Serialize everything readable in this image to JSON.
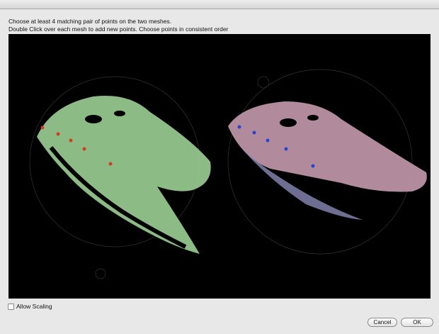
{
  "instructions": {
    "line1": "Choose at least 4 matching pair of points on the two meshes.",
    "line2": "Double Click over each mesh to add new points. Choose points in consistent order"
  },
  "options": {
    "allow_scaling_label": "Allow Scaling",
    "allow_scaling_checked": false
  },
  "buttons": {
    "cancel": "Cancel",
    "ok": "OK"
  },
  "colors": {
    "left_mesh": "#a8d8a0",
    "right_mesh": "#c89aa8",
    "left_points": "#d04020",
    "right_points": "#3040d0"
  }
}
